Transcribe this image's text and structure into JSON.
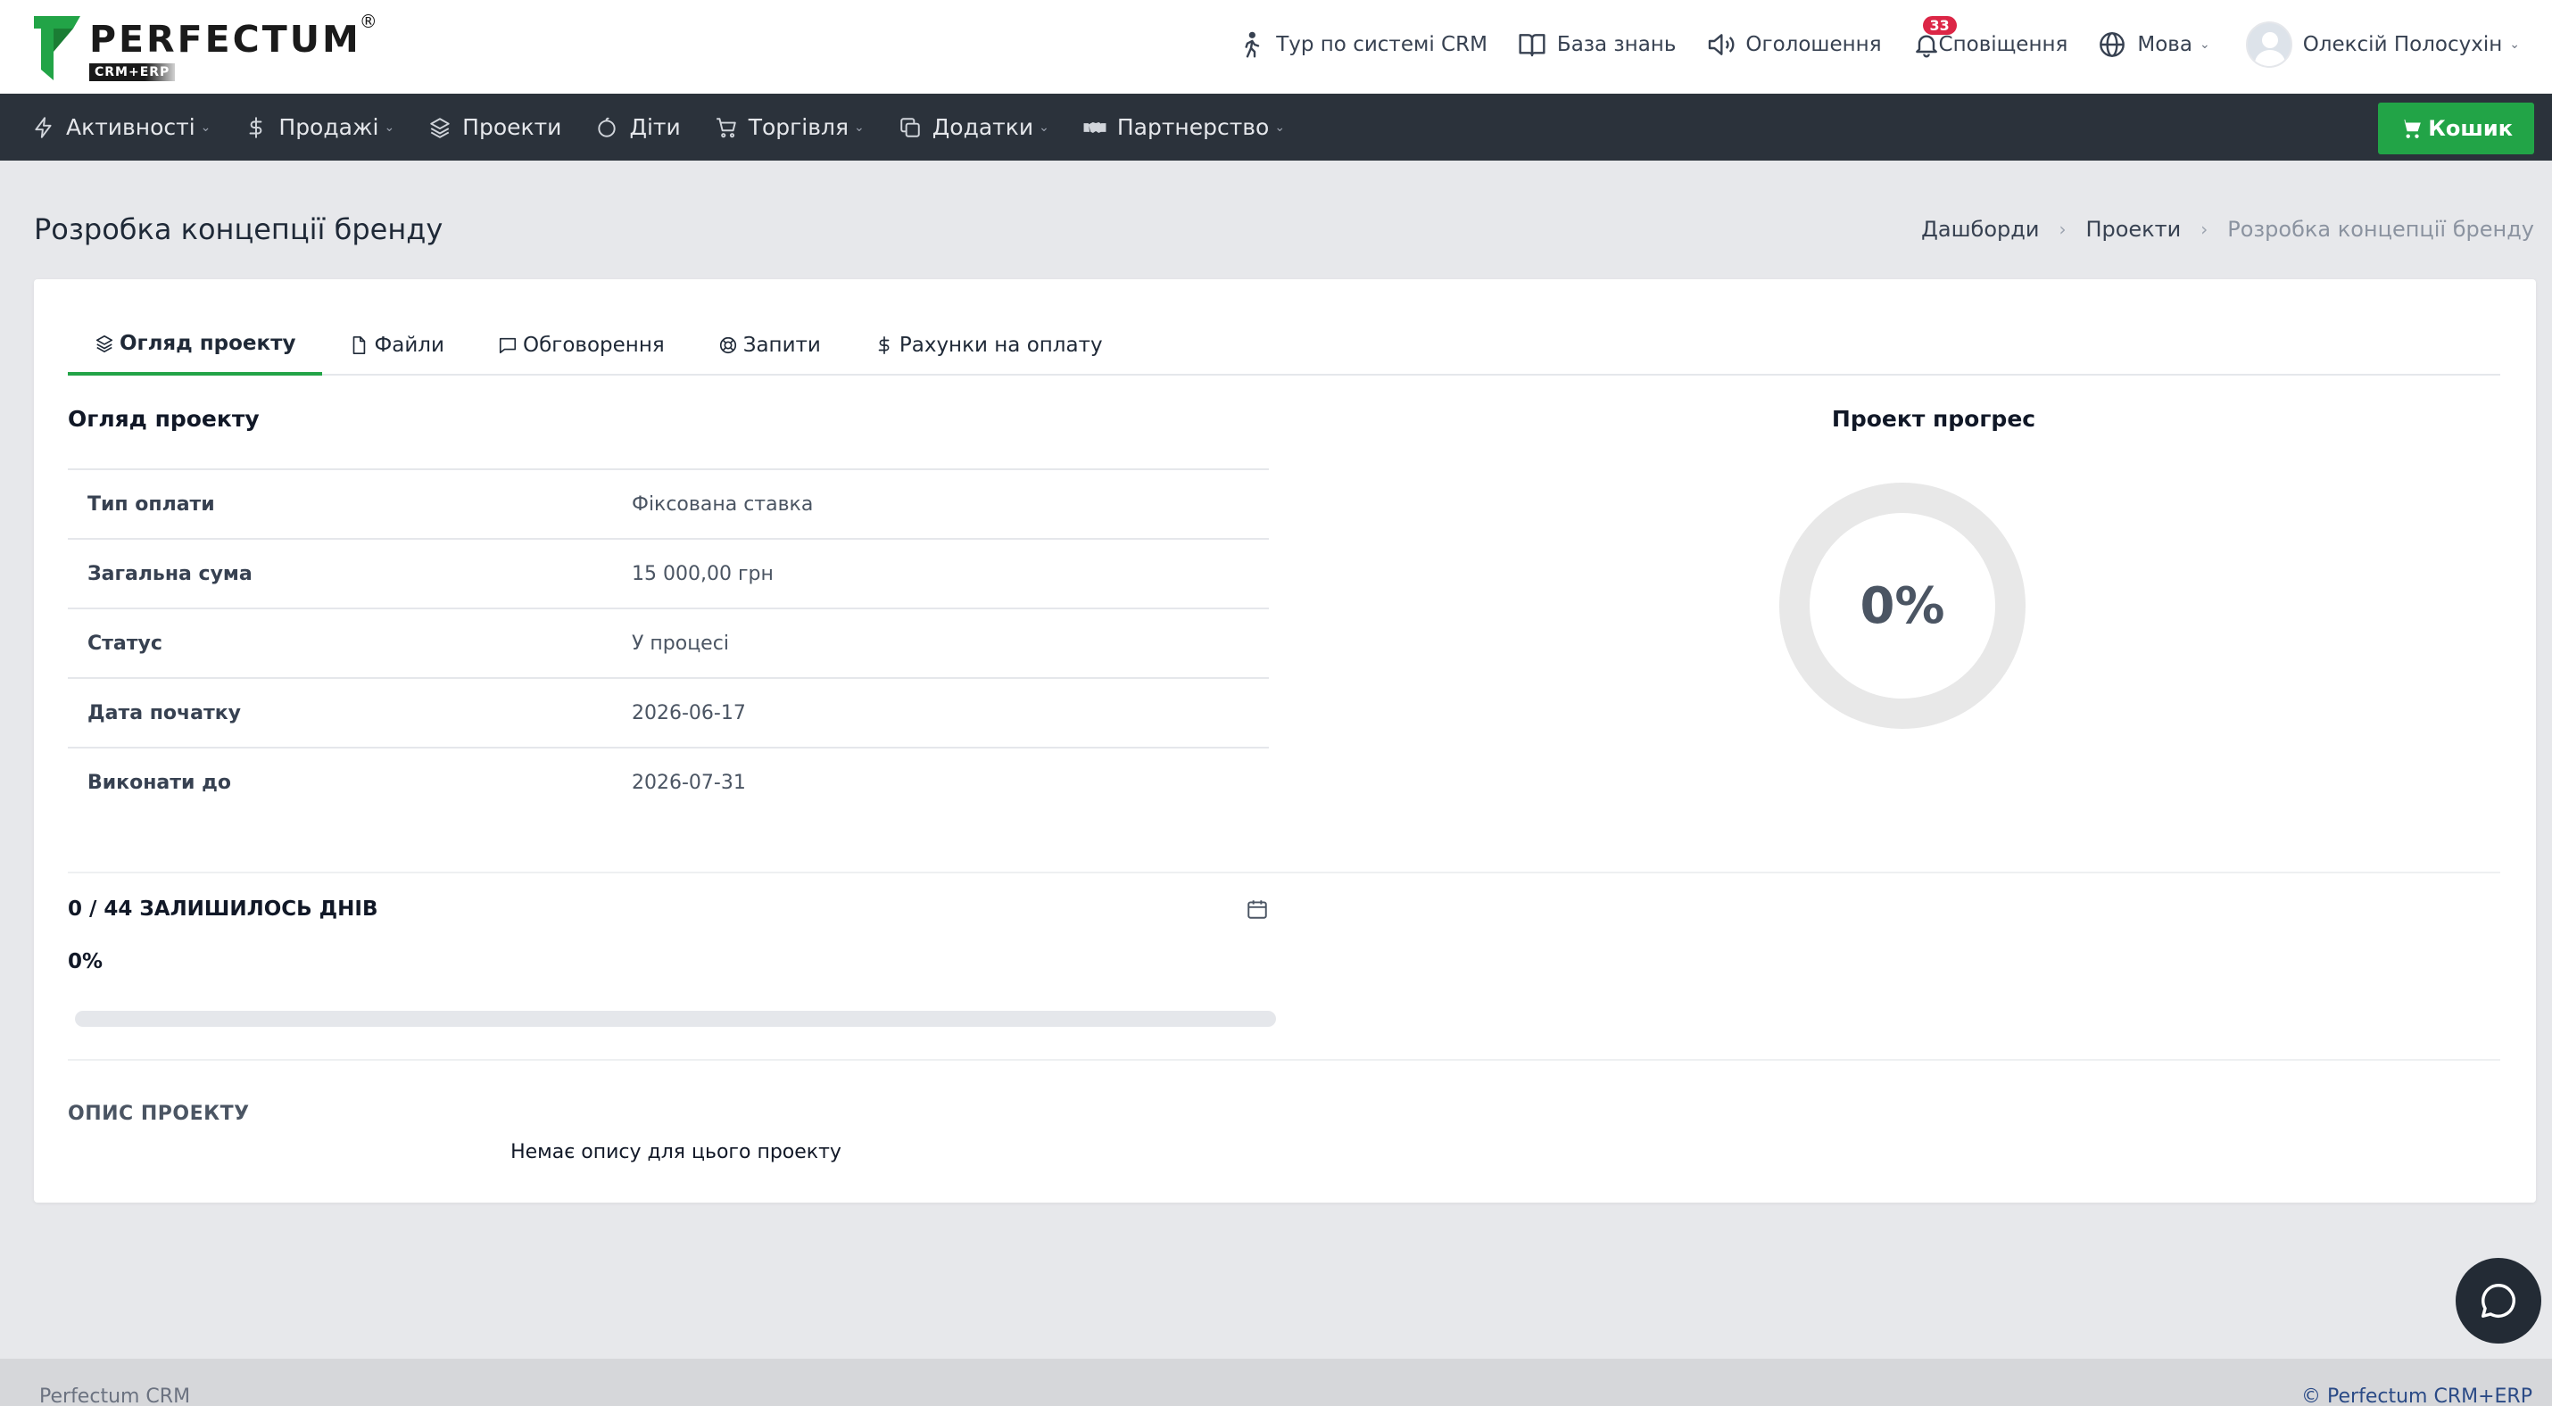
{
  "brand": {
    "name": "PERFECTUM",
    "registered": "®",
    "sub": "CRM+ERP",
    "accent_color": "#22a447",
    "nav_bg": "#2b323b"
  },
  "header": {
    "tour": "Тур по системі CRM",
    "knowledge": "База знань",
    "announcements": "Оголошення",
    "notifications": "Сповіщення",
    "notifications_count": "33",
    "language": "Мова",
    "user_name": "Олексій Полосухін"
  },
  "nav": {
    "items": [
      {
        "label": "Активності",
        "icon": "bolt-icon",
        "dropdown": true
      },
      {
        "label": "Продажі",
        "icon": "dollar-icon",
        "dropdown": true
      },
      {
        "label": "Проекти",
        "icon": "layers-icon",
        "dropdown": false
      },
      {
        "label": "Діти",
        "icon": "face-icon",
        "dropdown": false
      },
      {
        "label": "Торгівля",
        "icon": "cart-icon",
        "dropdown": true
      },
      {
        "label": "Додатки",
        "icon": "copy-icon",
        "dropdown": true
      },
      {
        "label": "Партнерство",
        "icon": "handshake-icon",
        "dropdown": true
      }
    ],
    "cart_label": "Кошик"
  },
  "page": {
    "title": "Розробка концепції бренду",
    "breadcrumb": [
      "Дашборди",
      "Проекти",
      "Розробка концепції бренду"
    ]
  },
  "tabs": [
    {
      "label": "Огляд проекту",
      "active": true
    },
    {
      "label": "Файли",
      "active": false
    },
    {
      "label": "Обговорення",
      "active": false
    },
    {
      "label": "Запити",
      "active": false
    },
    {
      "label": "Рахунки на оплату",
      "active": false
    }
  ],
  "overview": {
    "title": "Огляд проекту",
    "rows": [
      {
        "key": "Тип оплати",
        "value": "Фіксована ставка"
      },
      {
        "key": "Загальна сума",
        "value": "15 000,00 грн"
      },
      {
        "key": "Статус",
        "value": "У процесі"
      },
      {
        "key": "Дата початку",
        "value": "2026-06-17"
      },
      {
        "key": "Виконати до",
        "value": "2026-07-31"
      }
    ]
  },
  "progress": {
    "title": "Проект прогрес",
    "label": "0%",
    "value": 0
  },
  "days": {
    "label": "0 / 44 ЗАЛИШИЛОСЬ ДНІВ",
    "percent_label": "0%",
    "fraction": 0
  },
  "description": {
    "title": "ОПИС ПРОЕКТУ",
    "empty_text": "Немає опису для цього проекту"
  },
  "footer": {
    "left": "Perfectum CRM",
    "right": "© Perfectum CRM+ERP"
  }
}
